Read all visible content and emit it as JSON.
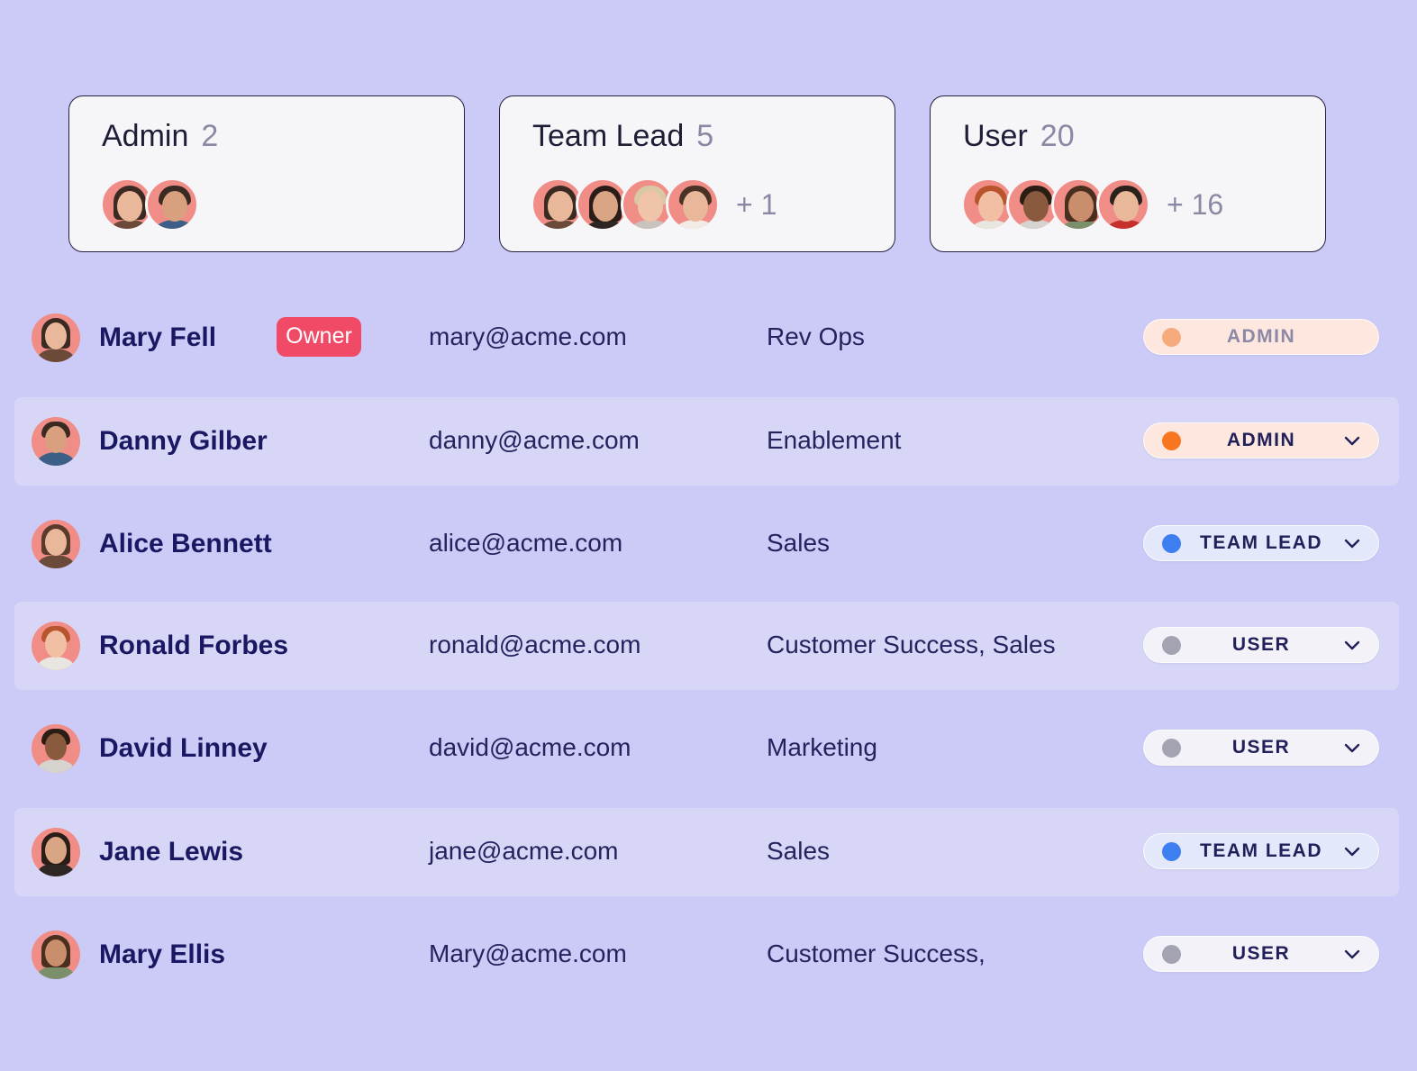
{
  "role_cards": [
    {
      "title": "Admin",
      "count": "2",
      "more": ""
    },
    {
      "title": "Team Lead",
      "count": "5",
      "more": "+ 1"
    },
    {
      "title": "User",
      "count": "20",
      "more": "+ 16"
    }
  ],
  "owner_badge": "Owner",
  "users": [
    {
      "name": "Mary Fell",
      "email": "mary@acme.com",
      "team": "Rev Ops",
      "role": "ADMIN"
    },
    {
      "name": "Danny Gilber",
      "email": "danny@acme.com",
      "team": "Enablement",
      "role": "ADMIN"
    },
    {
      "name": "Alice Bennett",
      "email": "alice@acme.com",
      "team": "Sales",
      "role": "TEAM LEAD"
    },
    {
      "name": "Ronald Forbes",
      "email": "ronald@acme.com",
      "team": "Customer Success, Sales",
      "role": "USER"
    },
    {
      "name": "David Linney",
      "email": "david@acme.com",
      "team": "Marketing",
      "role": "USER"
    },
    {
      "name": "Jane Lewis",
      "email": "jane@acme.com",
      "team": "Sales",
      "role": "TEAM LEAD"
    },
    {
      "name": "Mary Ellis",
      "email": "Mary@acme.com",
      "team": "Customer Success,",
      "role": "USER"
    }
  ],
  "colors": {
    "background": "#cccaf6",
    "admin_dot_disabled": "#f7ab7d",
    "admin_dot": "#f7761f",
    "team_lead_dot": "#3d7ff0",
    "user_dot": "#a3a3b2",
    "owner_badge": "#f04a67"
  },
  "icons": {
    "avatar": "avatar-photo",
    "role_dropdown": "chevron-down-icon"
  }
}
